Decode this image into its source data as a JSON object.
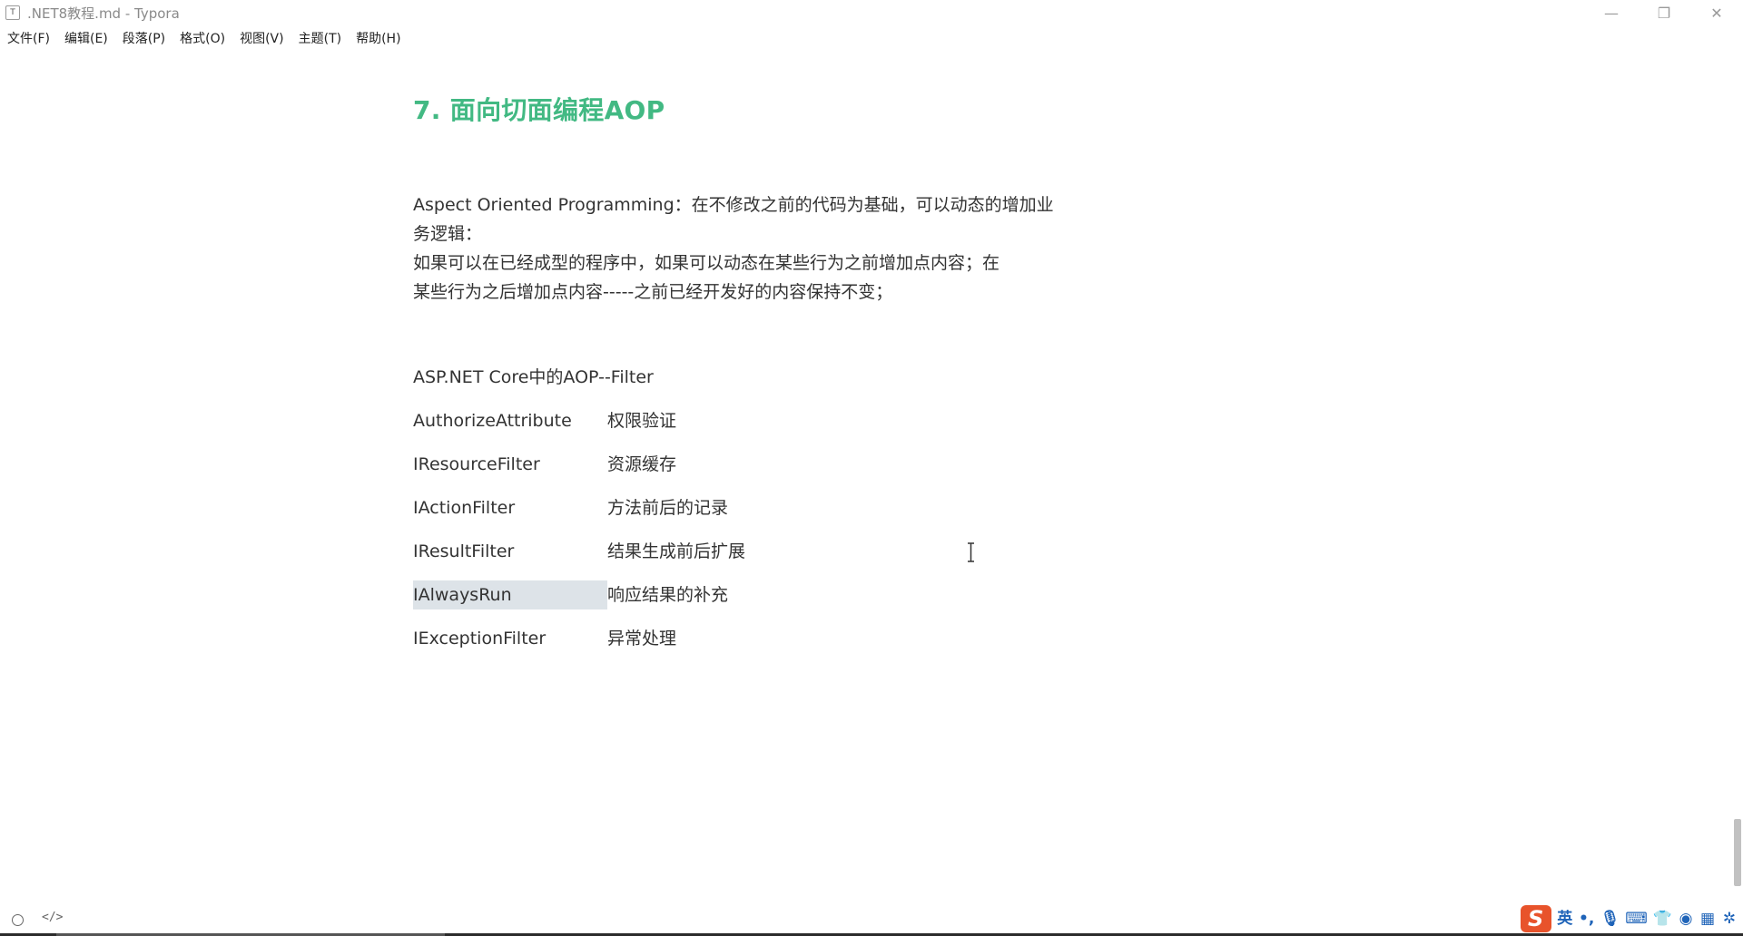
{
  "window": {
    "app_icon_letter": "T",
    "title": ".NET8教程.md - Typora",
    "minimize_glyph": "—",
    "restore_glyph": "❐",
    "close_glyph": "✕"
  },
  "menubar": {
    "items": [
      {
        "label": "文件(F)"
      },
      {
        "label": "编辑(E)"
      },
      {
        "label": "段落(P)"
      },
      {
        "label": "格式(O)"
      },
      {
        "label": "视图(V)"
      },
      {
        "label": "主题(T)"
      },
      {
        "label": "帮助(H)"
      }
    ]
  },
  "document": {
    "heading": "7. 面向切面编程AOP",
    "paragraph_lines": [
      "Aspect Oriented Programming：在不修改之前的代码为基础，可以动态的增加业",
      "务逻辑：",
      "如果可以在已经成型的程序中，如果可以动态在某些行为之前增加点内容；在",
      "某些行为之后增加点内容-----之前已经开发好的内容保持不变；"
    ],
    "filter_title": "ASP.NET Core中的AOP--Filter",
    "filters": [
      {
        "name": "AuthorizeAttribute",
        "desc": "权限验证"
      },
      {
        "name": "IResourceFilter",
        "desc": "资源缓存"
      },
      {
        "name": "IActionFilter",
        "desc": "方法前后的记录"
      },
      {
        "name": "IResultFilter",
        "desc": "结果生成前后扩展"
      },
      {
        "name": "IAlwaysRun",
        "desc": "响应结果的补充"
      },
      {
        "name": "IExceptionFilter",
        "desc": "异常处理"
      }
    ]
  },
  "statusbar": {
    "source_mode_glyph": "</>"
  },
  "ime": {
    "logo": "S",
    "mode": "英",
    "punct": "•,",
    "icons": [
      "mic-icon",
      "keyboard-icon",
      "shirt-icon",
      "game-icon",
      "apps-icon",
      "settings-icon"
    ],
    "icon_glyphs": [
      "🎙",
      "⌨",
      "👕",
      "◉",
      "▦",
      "✲"
    ]
  },
  "colors": {
    "heading": "#42b983",
    "ime_logo": "#e8532b",
    "ime_icons": "#1e63b8"
  }
}
